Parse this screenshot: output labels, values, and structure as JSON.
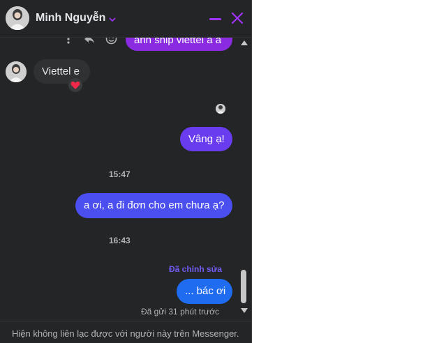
{
  "header": {
    "contact_name": "Minh Nguyễn",
    "avatar": "contact-avatar",
    "chevron": "chevron-down-icon",
    "minimize": "minimize-icon",
    "close": "close-icon",
    "accent_color": "#a033ff"
  },
  "messages": [
    {
      "id": "m1",
      "sender": "me",
      "text": "anh ship viettel a a",
      "color": "#8a2be2"
    },
    {
      "id": "m2",
      "sender": "contact",
      "text": "Viettel e",
      "reaction": "❤️"
    },
    {
      "id": "m3",
      "sender": "me",
      "text": "Vâng ạ!",
      "color": "#6a3cf0"
    },
    {
      "id": "m4",
      "sender": "me",
      "text": "a ơi, a đi đơn cho em chưa ạ?",
      "color": "#4b4ff0"
    },
    {
      "id": "m5",
      "sender": "me",
      "text": "... bác ơi",
      "color": "#1f6cf0"
    }
  ],
  "timestamps": {
    "t1": "15:47",
    "t2": "16:43"
  },
  "edited_label": "Đã chỉnh sửa",
  "sent_status": "Đã gửi 31 phút trước",
  "message_tools": [
    "more-icon",
    "reply-icon",
    "emoji-icon"
  ],
  "footer_text": "Hiện không liên lạc được với người này trên Messenger."
}
